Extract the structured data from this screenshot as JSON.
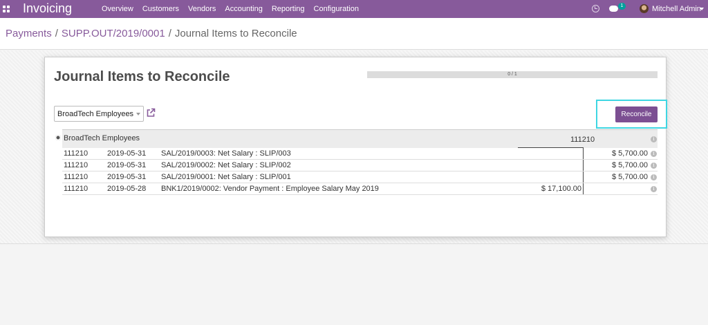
{
  "app": {
    "title": "Invoicing"
  },
  "menu": [
    "Overview",
    "Customers",
    "Vendors",
    "Accounting",
    "Reporting",
    "Configuration"
  ],
  "navbar": {
    "messages_count": "1",
    "user_name": "Mitchell Admin"
  },
  "breadcrumb": {
    "items": [
      "Payments",
      "SUPP.OUT/2019/0001"
    ],
    "current": "Journal Items to Reconcile",
    "separator": "/"
  },
  "page": {
    "title": "Journal Items to Reconcile",
    "progress_text": "0 / 1",
    "progress_fraction": 0
  },
  "partner_select": {
    "value": "BroadTech Employees"
  },
  "reconcile_button": {
    "label": "Reconcile"
  },
  "group": {
    "name": "BroadTech Employees",
    "account": "111210"
  },
  "rows": [
    {
      "account": "111210",
      "date": "2019-05-31",
      "label": "SAL/2019/0003: Net Salary : SLIP/003",
      "debit": "",
      "credit": "$ 5,700.00"
    },
    {
      "account": "111210",
      "date": "2019-05-31",
      "label": "SAL/2019/0002: Net Salary : SLIP/002",
      "debit": "",
      "credit": "$ 5,700.00"
    },
    {
      "account": "111210",
      "date": "2019-05-31",
      "label": "SAL/2019/0001: Net Salary : SLIP/001",
      "debit": "",
      "credit": "$ 5,700.00"
    },
    {
      "account": "111210",
      "date": "2019-05-28",
      "label": "BNK1/2019/0002: Vendor Payment : Employee Salary May 2019",
      "debit": "$ 17,100.00",
      "credit": ""
    }
  ],
  "colors": {
    "brand": "#875a9b",
    "button": "#7c4f92",
    "highlight": "#3ed6e2",
    "badge": "#00a09d"
  },
  "icons": [
    "apps-icon",
    "clock-icon",
    "chat-icon",
    "caret-down-icon",
    "external-link-icon",
    "gear-icon",
    "info-icon"
  ]
}
